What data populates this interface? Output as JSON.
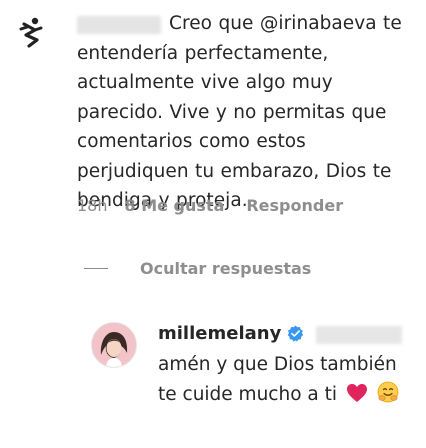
{
  "comment": {
    "text": "Creo que @irinabaeva te entendería perfectamente, actualmente vive algo muy parecido. Vive y no permitas que comentarios como estos perjudiquen tu embarazo, Dios te bendiga y proteja.",
    "time": "18h",
    "likes": "8 Me gusta",
    "reply_label": "Responder"
  },
  "hide_replies_label": "Ocultar respuestas",
  "reply": {
    "username": "millemelany",
    "text": "amén y que Dios también te cuide mucho a ti",
    "emojis": [
      "red-heart",
      "hugging-face"
    ]
  },
  "colors": {
    "text": "#262626",
    "muted": "#8e8e8e",
    "verified": "#3897f0",
    "heart": "#e0245e"
  }
}
